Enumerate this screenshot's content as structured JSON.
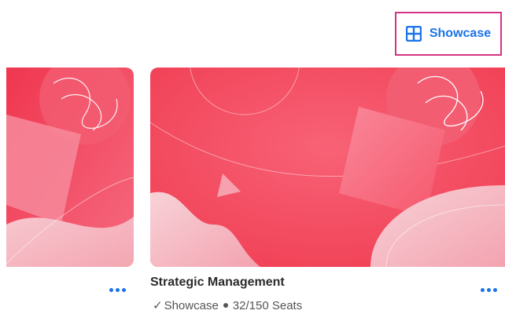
{
  "header": {
    "showcase_button": {
      "label": "Showcase",
      "icon": "grid-icon",
      "accent_color": "#1a73e8",
      "highlight_border_color": "#d63384"
    }
  },
  "cards": [
    {
      "id": "card-left-partial",
      "more_icon": "ellipsis-icon"
    },
    {
      "id": "card-main",
      "title": "Strategic Management",
      "status_check": "✓",
      "status_label": "Showcase",
      "seats": "32/150 Seats",
      "more_icon": "ellipsis-icon"
    }
  ],
  "theme": {
    "card_red": "#f0364f",
    "card_light_pink": "#f7c7cf"
  }
}
